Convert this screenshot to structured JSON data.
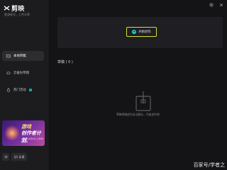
{
  "app": {
    "name": "剪映",
    "login_hint": "登录帐号，上传天草"
  },
  "sidebar": {
    "items": [
      {
        "label": "本地草稿",
        "icon": "folder-icon",
        "active": true
      },
      {
        "label": "云备份草稿",
        "icon": "cloud-icon",
        "active": false
      },
      {
        "label": "热门活动",
        "icon": "fire-icon",
        "active": false,
        "badge": "N"
      }
    ],
    "banner": {
      "line1": "游戏",
      "line2": "创作者计划",
      "line3": "7月5日-8月5日 上传作品投稿"
    },
    "bottom": {
      "settings_icon": "gear-icon",
      "feedback_label": "反馈"
    }
  },
  "topbar": {
    "icons": [
      "settings-icon",
      "close-icon"
    ]
  },
  "hero": {
    "start_label": "开始创作"
  },
  "drafts": {
    "title": "草稿 ( 0 )",
    "empty_text": "草稿将随创作自动保存，开始创作吧"
  },
  "watermark": "百家号/学者之"
}
